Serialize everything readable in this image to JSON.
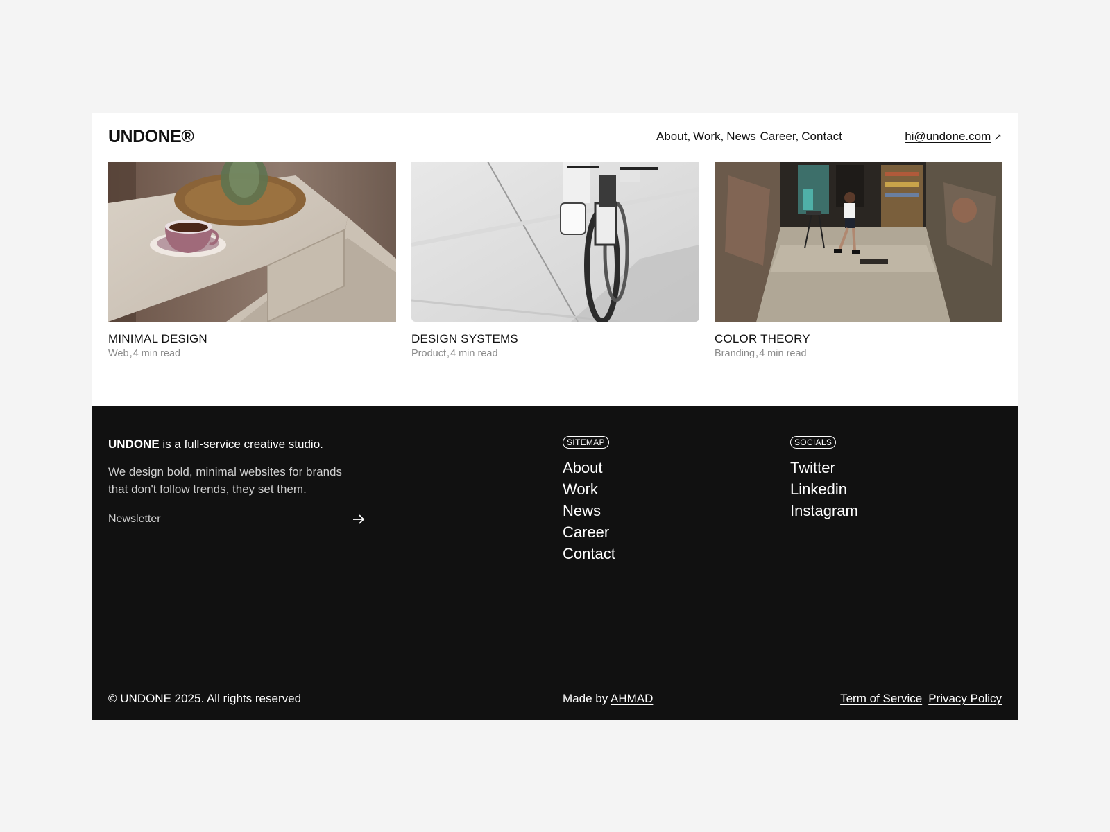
{
  "brand": {
    "logo": "UNDONE®"
  },
  "nav": {
    "items": [
      {
        "label": "About",
        "sep": ","
      },
      {
        "label": "Work",
        "sep": ","
      },
      {
        "label": "News",
        "sep": ""
      },
      {
        "label": "Career",
        "sep": ","
      },
      {
        "label": "Contact",
        "sep": ""
      }
    ],
    "email": "hi@undone.com",
    "email_arrow": "↗"
  },
  "cards": [
    {
      "title": "MINIMAL DESIGN",
      "category": "Web",
      "read_time": "4 min read",
      "image": "teacup-on-cabinet"
    },
    {
      "title": "DESIGN SYSTEMS",
      "category": "Product",
      "read_time": "4 min read",
      "image": "cyclist-on-road"
    },
    {
      "title": "COLOR THEORY",
      "category": "Branding",
      "read_time": "4 min read",
      "image": "boy-in-alley"
    }
  ],
  "footer": {
    "intro_bold": "UNDONE",
    "intro_rest": " is a full-service creative studio.",
    "description": "We design bold, minimal websites for brands that don't follow trends, they set them.",
    "newsletter_placeholder": "Newsletter",
    "sitemap_label": "SITEMAP",
    "sitemap": [
      "About",
      "Work",
      "News",
      "Career",
      "Contact"
    ],
    "socials_label": "SOCIALS",
    "socials": [
      "Twitter",
      "Linkedin",
      "Instagram"
    ],
    "copyright": "© UNDONE 2025. All rights reserved",
    "made_by_prefix": "Made by ",
    "made_by_name": "AHMAD",
    "legal": [
      "Term of Service",
      "Privacy Policy"
    ]
  },
  "colors": {
    "page_bg": "#f4f4f4",
    "card_bg": "#ffffff",
    "footer_bg": "#111111",
    "muted": "#8a8a8a"
  }
}
